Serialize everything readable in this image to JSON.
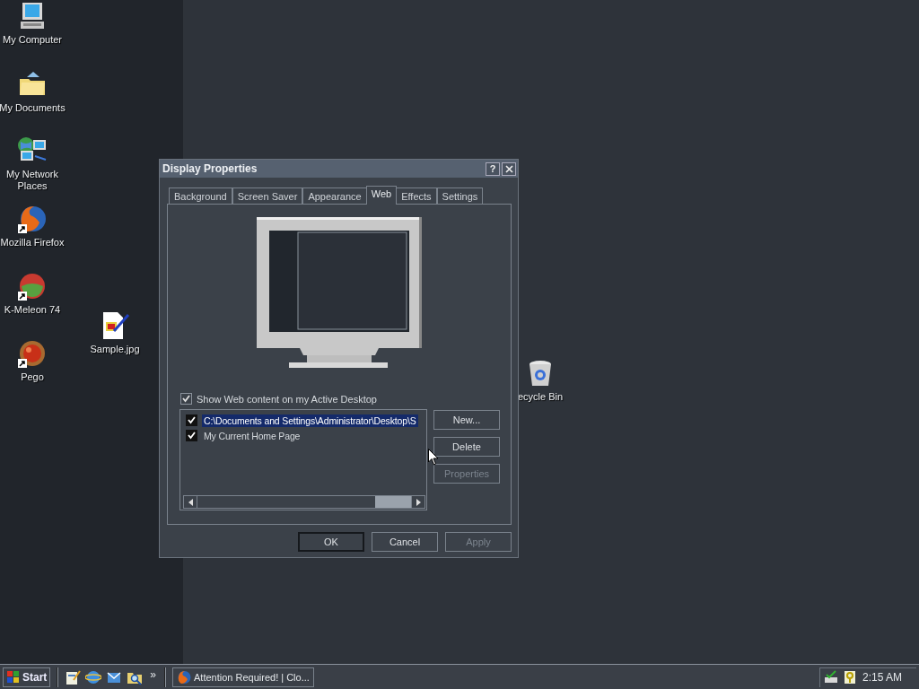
{
  "desktop": {
    "icons": [
      {
        "label": "My Computer",
        "kind": "computer",
        "shortcut": false
      },
      {
        "label": "My Documents",
        "kind": "documents",
        "shortcut": false
      },
      {
        "label": "My Network Places",
        "kind": "network",
        "shortcut": false
      },
      {
        "label": "Mozilla Firefox",
        "kind": "firefox",
        "shortcut": true
      },
      {
        "label": "K-Meleon 74",
        "kind": "kmeleon",
        "shortcut": true
      },
      {
        "label": "Pego",
        "kind": "pego",
        "shortcut": true
      },
      {
        "label": "Sample.jpg",
        "kind": "image",
        "shortcut": false
      },
      {
        "label": "ecycle Bin",
        "kind": "recycle",
        "shortcut": false
      }
    ]
  },
  "dialog": {
    "title": "Display Properties",
    "help_button": "?",
    "tabs": [
      {
        "label": "Background",
        "selected": false
      },
      {
        "label": "Screen Saver",
        "selected": false
      },
      {
        "label": "Appearance",
        "selected": false
      },
      {
        "label": "Web",
        "selected": true
      },
      {
        "label": "Effects",
        "selected": false
      },
      {
        "label": "Settings",
        "selected": false
      }
    ],
    "show_web_content": {
      "label": "Show Web content on my Active Desktop",
      "checked": true
    },
    "web_items": [
      {
        "label": "C:\\Documents and Settings\\Administrator\\Desktop\\S",
        "checked": true,
        "selected": true
      },
      {
        "label": "My Current Home Page",
        "checked": true,
        "selected": false
      }
    ],
    "side_buttons": [
      {
        "label": "New...",
        "disabled": false
      },
      {
        "label": "Delete",
        "disabled": false
      },
      {
        "label": "Properties",
        "disabled": true
      }
    ],
    "buttons": [
      {
        "label": "OK",
        "disabled": false,
        "default": true
      },
      {
        "label": "Cancel",
        "disabled": false,
        "default": false
      },
      {
        "label": "Apply",
        "disabled": true,
        "default": false
      }
    ]
  },
  "taskbar": {
    "start": "Start",
    "quick_launch": [
      {
        "kind": "notepad"
      },
      {
        "kind": "browser"
      },
      {
        "kind": "mail"
      },
      {
        "kind": "search"
      }
    ],
    "chevron": "»",
    "tasks": [
      {
        "label": "Attention Required! | Clo...",
        "kind": "firefox"
      }
    ],
    "tray_icons": [
      {
        "kind": "network"
      },
      {
        "kind": "key"
      }
    ],
    "clock": "2:15 AM"
  }
}
